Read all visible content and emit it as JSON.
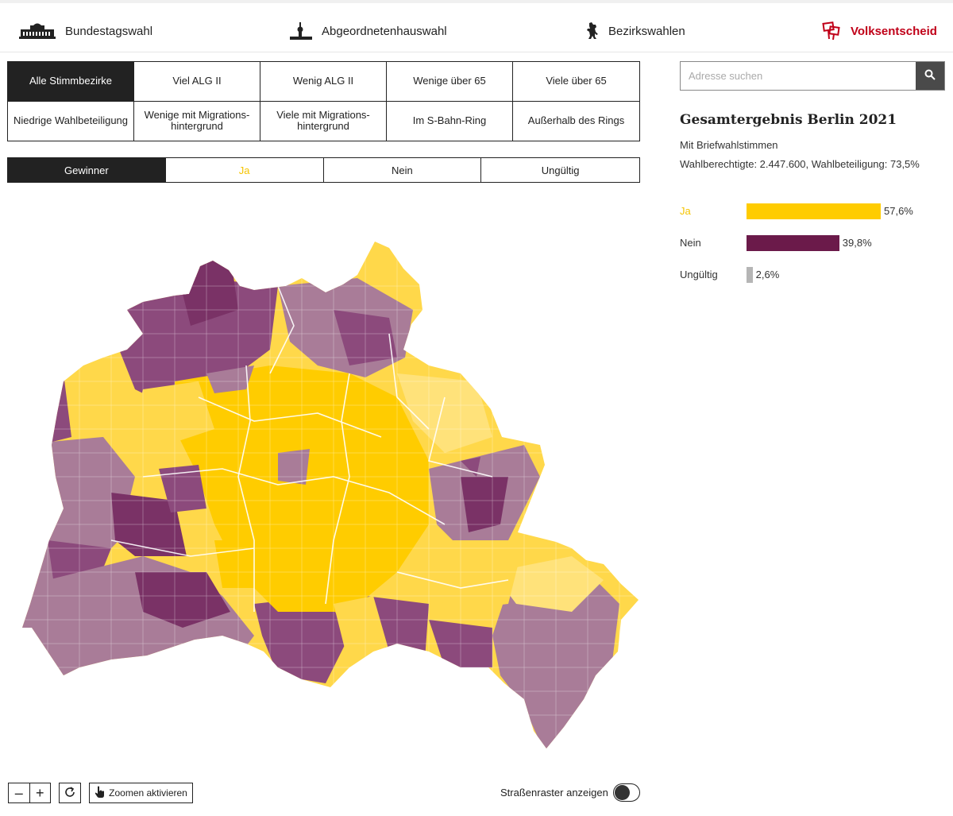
{
  "nav": [
    {
      "label": "Bundestagswahl",
      "icon": "reichstag-icon",
      "active": false
    },
    {
      "label": "Abgeordnetenhauswahl",
      "icon": "tv-tower-icon",
      "active": false
    },
    {
      "label": "Bezirkswahlen",
      "icon": "berlin-bear-icon",
      "active": false
    },
    {
      "label": "Volksentscheid",
      "icon": "protest-sign-icon",
      "active": true
    }
  ],
  "filters": [
    "Alle Stimmbezirke",
    "Viel ALG II",
    "Wenig ALG II",
    "Wenige über 65",
    "Viele über 65",
    "Niedrige Wahlbeteiligung",
    "Wenige mit Migrations-\nhintergrund",
    "Viele mit Migrations-\nhintergrund",
    "Im S-Bahn-Ring",
    "Außerhalb des Rings"
  ],
  "active_filter": "Alle Stimmbezirke",
  "modes": [
    "Gewinner",
    "Ja",
    "Nein",
    "Ungültig"
  ],
  "active_mode": "Gewinner",
  "search": {
    "placeholder": "Adresse suchen"
  },
  "result": {
    "title": "Gesamtergebnis Berlin 2021",
    "subtitle": "Mit Briefwahlstimmen",
    "stats": "Wahlberechtigte: 2.447.600, Wahlbeteiligung: 73,5%",
    "rows": [
      {
        "label": "Ja",
        "value_text": "57,6%",
        "value": 57.6,
        "color": "#ffcc00",
        "label_color": "#f5c400"
      },
      {
        "label": "Nein",
        "value_text": "39,8%",
        "value": 39.8,
        "color": "#6b1a4a",
        "label_color": "#333333"
      },
      {
        "label": "Ungültig",
        "value_text": "2,6%",
        "value": 2.6,
        "color": "#b5b5b5",
        "label_color": "#333333"
      }
    ]
  },
  "map_colors": {
    "ja_strong": "#ffcc00",
    "ja_light": "#ffe27a",
    "nein_strong": "#7a3266",
    "nein_light": "#a97c98"
  },
  "controls": {
    "zoom_out": "–",
    "zoom_in": "+",
    "zoom_activate": "Zoomen aktivieren",
    "street_grid": "Straßenraster anzeigen",
    "street_grid_on": false
  }
}
